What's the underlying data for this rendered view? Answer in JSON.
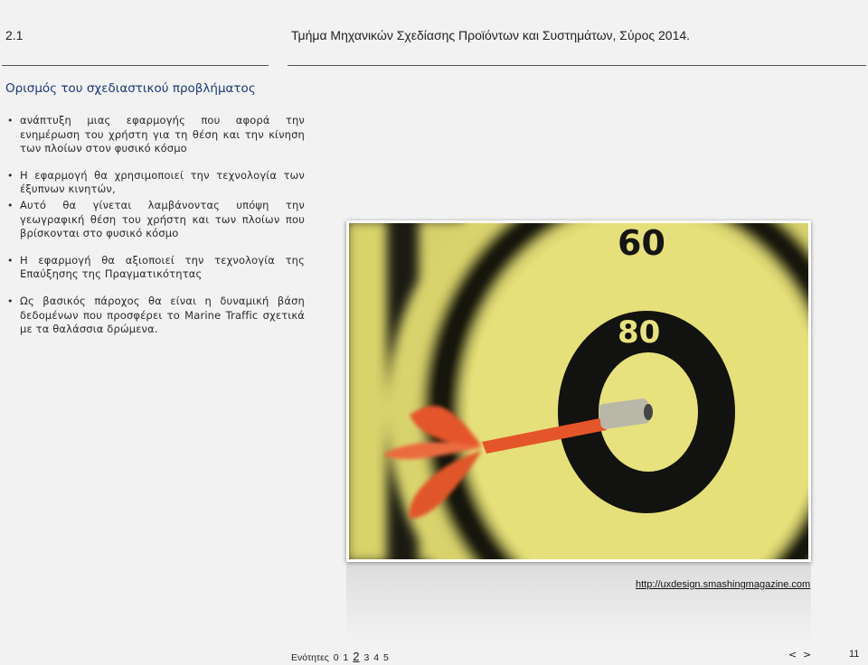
{
  "header": {
    "number": "2.1",
    "title": "Τμήμα Μηχανικών Σχεδίασης Προϊόντων και Συστημάτων, Σύρος 2014."
  },
  "section": {
    "heading": "Ορισμός του σχεδιαστικού προβλήματος"
  },
  "bullets": [
    "ανάπτυξη μιας εφαρμογής που αφορά την ενημέρωση του χρήστη για τη θέση και την κίνηση των πλοίων στον φυσικό κόσμο",
    "Η εφαρμογή θα χρησιμοποιεί την τεχνολογία των έξυπνων κινητών,",
    "Αυτό θα γίνεται λαμβάνοντας υπόψη την γεωγραφική θέση του χρήστη και των πλοίων που βρίσκονται στο φυσικό κόσμο",
    "Η εφαρμογή θα αξιοποιεί την τεχνολογία της Επαύξησης της Πραγματικότητας",
    "Ως βασικός πάροχος θα είναι η δυναμική βάση δεδομένων που προσφέρει το Marine Traffic σχετικά με τα θαλάσσια δρώμενα."
  ],
  "image": {
    "label_60": "60",
    "label_80": "80",
    "source_link": "http://uxdesign.smashingmagazine.com"
  },
  "footer": {
    "sections_label": "Ενότητες",
    "sections": [
      "0",
      "1",
      "2",
      "3",
      "4",
      "5"
    ],
    "current_section": "2",
    "prev": "<",
    "next": ">",
    "page_number": "11"
  },
  "colors": {
    "heading": "#1d3a7a",
    "board_yellow": "#e8e27a",
    "board_black": "#111111",
    "dart": "#e5552a"
  }
}
